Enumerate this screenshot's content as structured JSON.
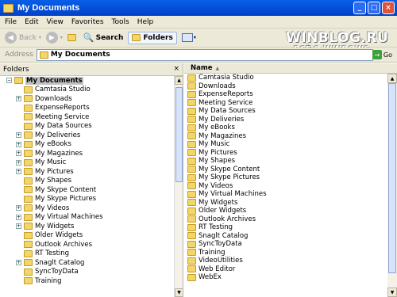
{
  "window": {
    "title": "My Documents"
  },
  "menu": [
    "File",
    "Edit",
    "View",
    "Favorites",
    "Tools",
    "Help"
  ],
  "toolbar": {
    "back": "Back",
    "search": "Search",
    "folders": "Folders"
  },
  "address": {
    "label": "Address",
    "value": "My Documents",
    "go": "Go"
  },
  "watermark": {
    "line1": "WINBLOG.RU",
    "line2": "ВСЁ О WINDOWS"
  },
  "folders_pane": {
    "title": "Folders",
    "close": "×",
    "items": [
      {
        "label": "My Documents",
        "expand": "−",
        "root": true,
        "selected": true
      },
      {
        "label": "Camtasia Studio",
        "expand": ""
      },
      {
        "label": "Downloads",
        "expand": "+"
      },
      {
        "label": "ExpenseReports",
        "expand": ""
      },
      {
        "label": "Meeting Service",
        "expand": ""
      },
      {
        "label": "My Data Sources",
        "expand": ""
      },
      {
        "label": "My Deliveries",
        "expand": "+"
      },
      {
        "label": "My eBooks",
        "expand": "+"
      },
      {
        "label": "My Magazines",
        "expand": "+"
      },
      {
        "label": "My Music",
        "expand": "+"
      },
      {
        "label": "My Pictures",
        "expand": "+"
      },
      {
        "label": "My Shapes",
        "expand": ""
      },
      {
        "label": "My Skype Content",
        "expand": ""
      },
      {
        "label": "My Skype Pictures",
        "expand": ""
      },
      {
        "label": "My Videos",
        "expand": "+"
      },
      {
        "label": "My Virtual Machines",
        "expand": "+"
      },
      {
        "label": "My Widgets",
        "expand": "+"
      },
      {
        "label": "Older Widgets",
        "expand": ""
      },
      {
        "label": "Outlook Archives",
        "expand": ""
      },
      {
        "label": "RT Testing",
        "expand": ""
      },
      {
        "label": "Snaglt Catalog",
        "expand": "+"
      },
      {
        "label": "SyncToyData",
        "expand": ""
      },
      {
        "label": "Training",
        "expand": ""
      }
    ]
  },
  "content": {
    "column_name": "Name",
    "items": [
      "Camtasia Studio",
      "Downloads",
      "ExpenseReports",
      "Meeting Service",
      "My Data Sources",
      "My Deliveries",
      "My eBooks",
      "My Magazines",
      "My Music",
      "My Pictures",
      "My Shapes",
      "My Skype Content",
      "My Skype Pictures",
      "My Videos",
      "My Virtual Machines",
      "My Widgets",
      "Older Widgets",
      "Outlook Archives",
      "RT Testing",
      "Snaglt Catalog",
      "SyncToyData",
      "Training",
      "VideoUtilities",
      "Web Editor",
      "WebEx"
    ]
  }
}
